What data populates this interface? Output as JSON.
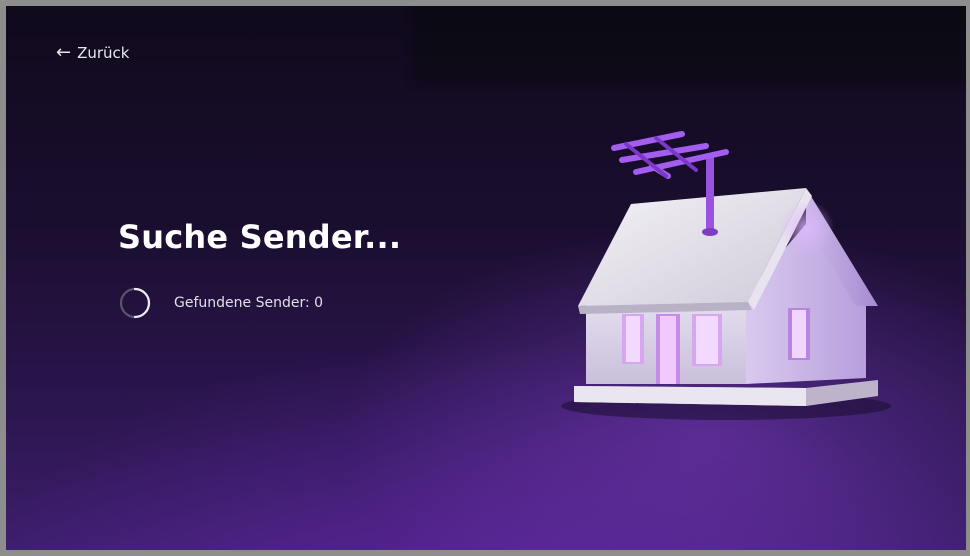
{
  "header": {
    "back_label": "Zurück",
    "back_icon": "left-arrow-icon"
  },
  "main": {
    "title": "Suche Sender...",
    "status_label": "Gefundene Sender: 0",
    "spinner_icon": "loading-spinner-icon"
  },
  "illustration": {
    "name": "house-with-antenna-illustration",
    "accent_color": "#8e44d8"
  }
}
